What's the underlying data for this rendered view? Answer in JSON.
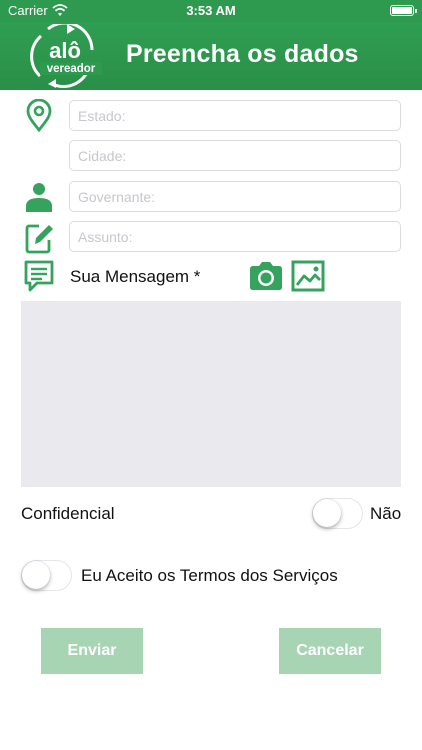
{
  "status_bar": {
    "carrier": "Carrier",
    "time": "3:53 AM"
  },
  "header": {
    "title": "Preencha os dados",
    "logo_text_top": "alô",
    "logo_text_bottom": "vereador"
  },
  "form": {
    "estado_placeholder": "Estado:",
    "cidade_placeholder": "Cidade:",
    "governante_placeholder": "Governante:",
    "assunto_placeholder": "Assunto:",
    "message_label": "Sua Mensagem *",
    "confidential_label": "Confidencial",
    "confidential_value_label": "Não",
    "confidential_on": false,
    "terms_label": "Eu Aceito os Termos dos Serviços",
    "terms_on": false
  },
  "buttons": {
    "send_label": "Enviar",
    "cancel_label": "Cancelar"
  },
  "icons": {
    "location": "map-pin-icon",
    "person": "person-icon",
    "edit": "edit-icon",
    "message": "message-icon",
    "camera": "camera-icon",
    "gallery": "image-gallery-icon"
  },
  "colors": {
    "brand_green": "#2e9a4f",
    "icon_green": "#35a35d",
    "button_disabled": "#a7d5b4",
    "message_bg": "#e9e9ee"
  }
}
